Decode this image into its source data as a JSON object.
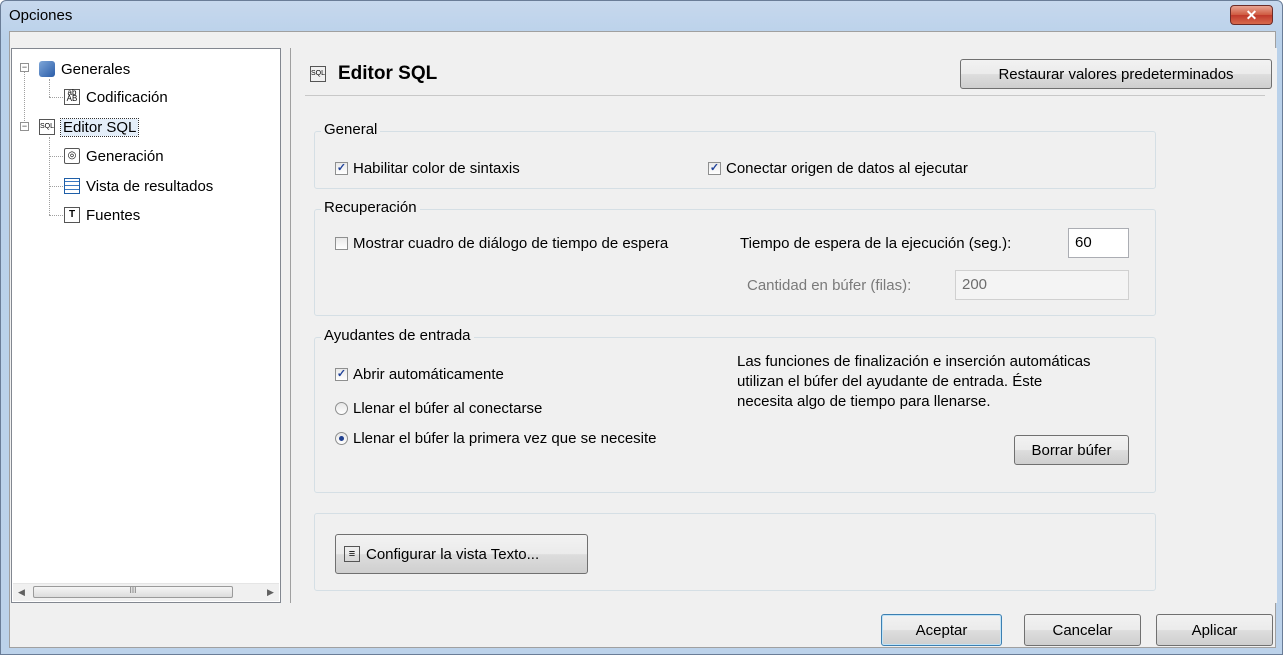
{
  "window": {
    "title": "Opciones",
    "close_glyph": "✕"
  },
  "tree": {
    "items": [
      {
        "label": "Generales",
        "icon": "general-settings-icon",
        "expanded": true
      },
      {
        "label": "Codificación",
        "icon": "encoding-icon"
      },
      {
        "label": "Editor SQL",
        "icon": "sql-editor-icon",
        "expanded": true,
        "selected": true
      },
      {
        "label": "Generación",
        "icon": "generation-icon"
      },
      {
        "label": "Vista de resultados",
        "icon": "results-grid-icon"
      },
      {
        "label": "Fuentes",
        "icon": "fonts-icon"
      }
    ],
    "scroll_thumb_glyph": "III"
  },
  "header": {
    "title": "Editor SQL",
    "icon": "sql-editor-icon",
    "restore_label": "Restaurar valores predeterminados"
  },
  "general": {
    "label": "General",
    "syntax_color": {
      "label": "Habilitar color de sintaxis",
      "checked": true
    },
    "connect_on_execute": {
      "label": "Conectar origen de datos al ejecutar",
      "checked": true
    }
  },
  "recovery": {
    "label": "Recuperación",
    "show_timeout_dialog": {
      "label": "Mostrar cuadro de diálogo de tiempo de espera",
      "checked": false
    },
    "timeout_label": "Tiempo de espera de la ejecución (seg.):",
    "timeout_value": "60",
    "buffer_label": "Cantidad en búfer (filas):",
    "buffer_value": "200"
  },
  "helpers": {
    "label": "Ayudantes de entrada",
    "auto_open": {
      "label": "Abrir automáticamente",
      "checked": true
    },
    "fill_on_connect": {
      "label": "Llenar el búfer al conectarse",
      "selected": false
    },
    "fill_first_needed": {
      "label": "Llenar el búfer la primera vez que se necesite",
      "selected": true
    },
    "description": [
      "Las funciones de finalización e inserción automáticas",
      "utilizan el búfer del ayudante de entrada. Éste",
      "necesita algo de tiempo para llenarse."
    ],
    "clear_buffer_label": "Borrar búfer"
  },
  "text_view": {
    "configure_label": "Configurar la vista Texto..."
  },
  "footer": {
    "ok_label": "Aceptar",
    "cancel_label": "Cancelar",
    "apply_label": "Aplicar"
  },
  "colors": {
    "accent": "#3c7fb1",
    "check": "#21439a",
    "title_bar": "#b9d1ea"
  }
}
